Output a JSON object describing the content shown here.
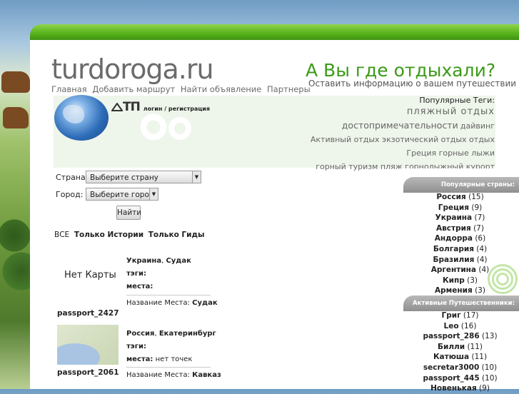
{
  "site": {
    "logo": "turdoroga.ru"
  },
  "nav": [
    "Главная",
    "Добавить маршрут",
    "Найти объявление",
    "Партнеры"
  ],
  "header": {
    "slogan": "А Вы где отдыхали?",
    "subslogan": "Оставить информацию о вашем путешествии"
  },
  "login": {
    "brand": "ТП",
    "login": "логин",
    "sep": " / ",
    "register": "регистрация"
  },
  "tags": {
    "title": "Популярные Теги:",
    "rows": [
      [
        {
          "text": "пляжный отдых",
          "size": "big"
        }
      ],
      [
        {
          "text": "достопримечательности",
          "size": "med"
        },
        {
          "text": "дайвинг",
          "size": "sm"
        }
      ],
      [
        {
          "text": "Активный отдых экзотический отдых отдых",
          "size": "sm"
        }
      ],
      [
        {
          "text": "Греция горные лыжи",
          "size": "sm"
        }
      ],
      [
        {
          "text": "горный туризм пляж горнолыжный курорт",
          "size": "sm"
        }
      ]
    ]
  },
  "form": {
    "country_label": "Страна:",
    "country_value": "Выберите страну",
    "city_label": "Город:",
    "city_value": "Выберите город",
    "submit": "Найти"
  },
  "filters": {
    "all": "ВСЕ",
    "stories": "Только Истории",
    "guides": "Только Гиды"
  },
  "posts": [
    {
      "map": "Нет Карты",
      "user": "passport_2427",
      "country": "Украина",
      "city": "Судак",
      "tags_label": "тэги:",
      "tags_value": "",
      "places_label": "места:",
      "places_value": "",
      "place_name_label": "Название Места:",
      "place_name": "Судак"
    },
    {
      "map": "",
      "user": "passport_2061",
      "country": "Россия",
      "city": "Екатеринбург",
      "tags_label": "тэги:",
      "tags_value": "",
      "places_label": "места:",
      "places_value": "нет точек",
      "place_name_label": "Название Места:",
      "place_name": "Кавказ"
    }
  ],
  "popular_countries": {
    "title": "Популярные страны:",
    "items": [
      {
        "name": "Россия",
        "count": "(15)"
      },
      {
        "name": "Греция",
        "count": "(9)"
      },
      {
        "name": "Украина",
        "count": "(7)"
      },
      {
        "name": "Австрия",
        "count": "(7)"
      },
      {
        "name": "Андорра",
        "count": "(6)"
      },
      {
        "name": "Болгария",
        "count": "(4)"
      },
      {
        "name": "Бразилия",
        "count": "(4)"
      },
      {
        "name": "Аргентина",
        "count": "(4)"
      },
      {
        "name": "Кипр",
        "count": "(3)"
      },
      {
        "name": "Армения",
        "count": "(3)"
      }
    ]
  },
  "active_travelers": {
    "title": "Активные Путешественники:",
    "items": [
      {
        "name": "Григ",
        "count": "(17)"
      },
      {
        "name": "Leo",
        "count": "(16)"
      },
      {
        "name": "passport_286",
        "count": "(13)"
      },
      {
        "name": "Билли",
        "count": "(11)"
      },
      {
        "name": "Катюша",
        "count": "(11)"
      },
      {
        "name": "secretar3000",
        "count": "(10)"
      },
      {
        "name": "passport_445",
        "count": "(10)"
      },
      {
        "name": "Новенькая",
        "count": "(9)"
      }
    ]
  },
  "colors": {
    "accent_green": "#3c9a18",
    "band_green": "#55b21a",
    "sidebar_head": "#8f8f8f"
  }
}
